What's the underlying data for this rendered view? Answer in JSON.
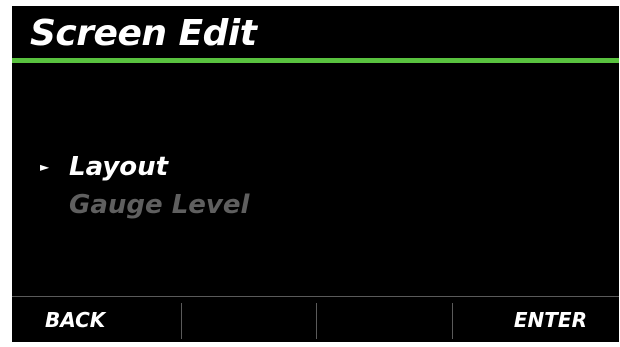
{
  "header": {
    "title": "Screen Edit"
  },
  "menu": {
    "pointer_glyph": "►",
    "items": [
      {
        "label": "Layout",
        "selected": true,
        "enabled": true
      },
      {
        "label": "Gauge Level",
        "selected": false,
        "enabled": false
      }
    ]
  },
  "softkeys": {
    "back_label": "BACK",
    "slot2_label": "",
    "slot3_label": "",
    "enter_label": "ENTER"
  },
  "colors": {
    "background": "#000000",
    "accent_rule": "#59c23f",
    "text_active": "#ffffff",
    "text_disabled": "#5f5f5f",
    "divider": "#5a5a5a",
    "bezel": "#ffffff"
  }
}
